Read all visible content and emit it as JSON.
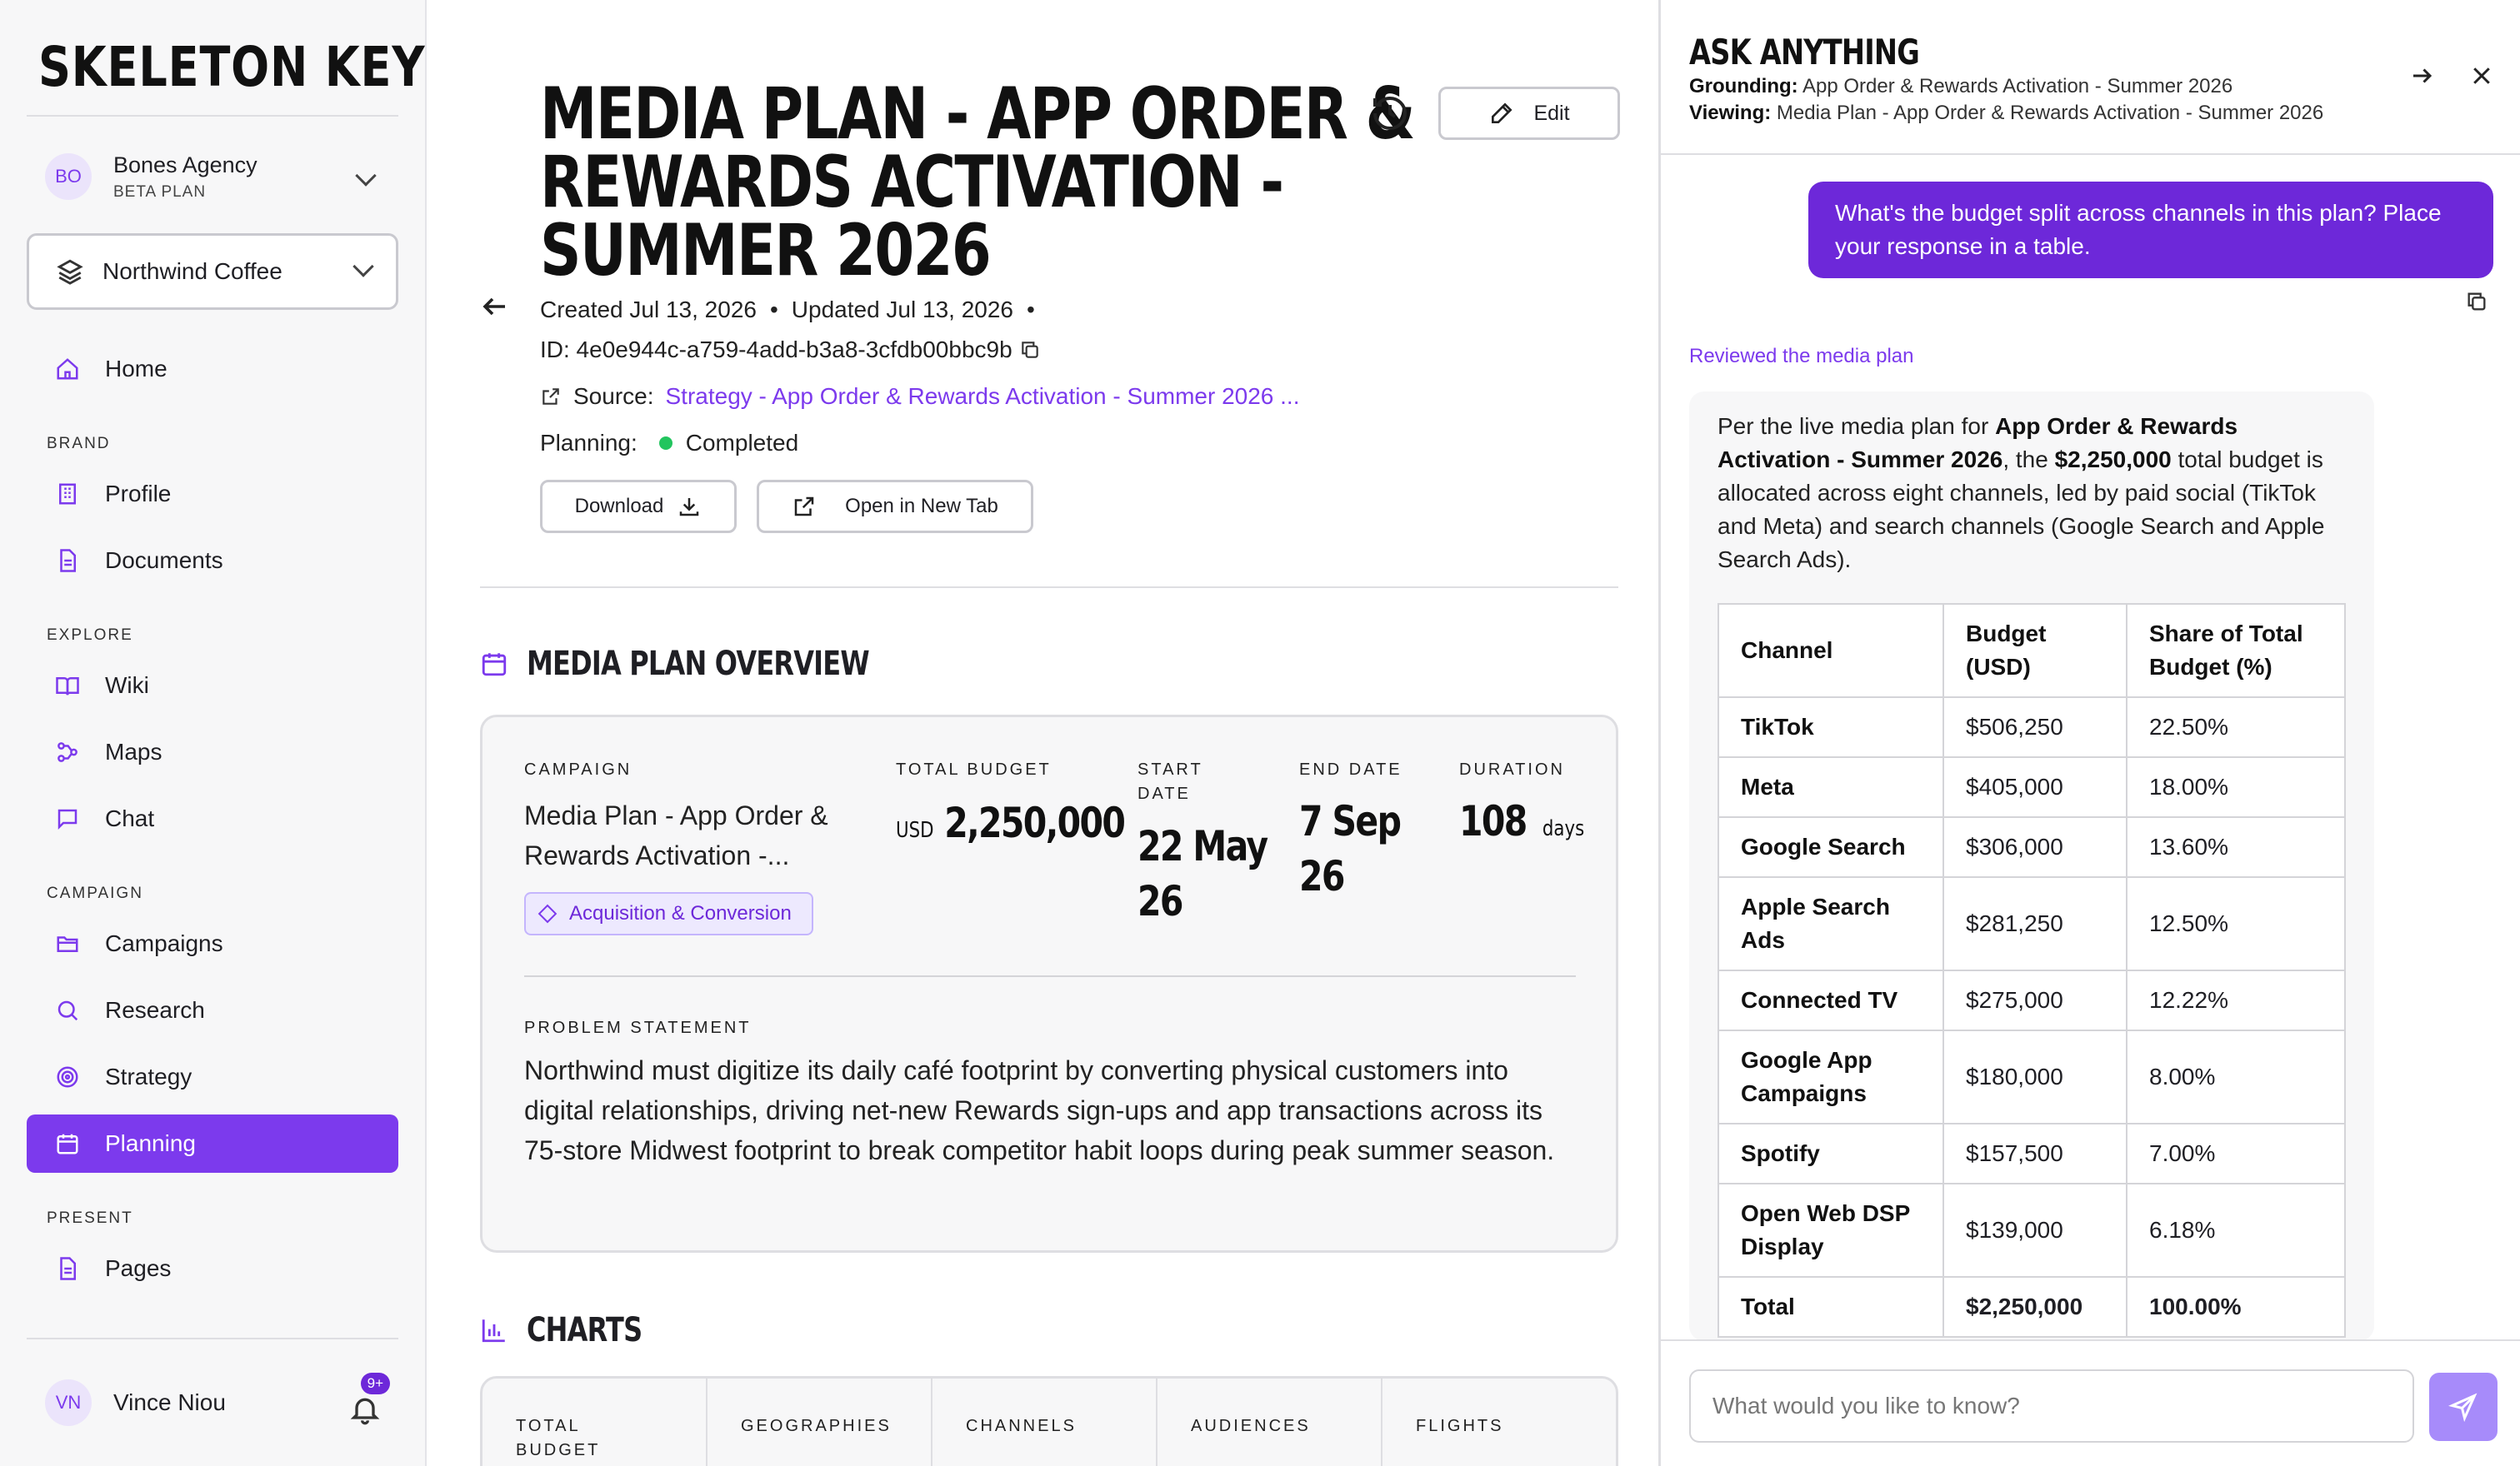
{
  "sidebar": {
    "logo": "SKELETON KEY",
    "agency": {
      "initials": "BO",
      "name": "Bones Agency",
      "plan": "BETA PLAN"
    },
    "brand_selector": "Northwind Coffee",
    "home": "Home",
    "sections": {
      "brand": "BRAND",
      "explore": "EXPLORE",
      "campaign": "CAMPAIGN",
      "present": "PRESENT"
    },
    "items": {
      "profile": "Profile",
      "documents": "Documents",
      "wiki": "Wiki",
      "maps": "Maps",
      "chat": "Chat",
      "campaigns": "Campaigns",
      "research": "Research",
      "strategy": "Strategy",
      "planning": "Planning",
      "pages": "Pages"
    },
    "user": {
      "initials": "VN",
      "name": "Vince Niou",
      "notifications": "9+"
    }
  },
  "main": {
    "title_lines": [
      "MEDIA PLAN - APP ORDER &",
      "REWARDS ACTIVATION -",
      "SUMMER 2026"
    ],
    "edit_label": "Edit",
    "created": "Created Jul 13, 2026",
    "updated": "Updated Jul 13, 2026",
    "dot": "•",
    "id_text": "ID: 4e0e944c-a759-4add-b3a8-3cfdb00bbc9b",
    "source_label": "Source:",
    "source_link": "Strategy - App Order & Rewards Activation - Summer 2026 ...",
    "planning_label": "Planning:",
    "planning_status": "Completed",
    "download_label": "Download",
    "open_tab_label": "Open in New Tab",
    "overview_title": "MEDIA PLAN OVERVIEW",
    "overview": {
      "campaign_label": "CAMPAIGN",
      "campaign_name": "Media Plan - App Order & Rewards Activation -...",
      "tag": "Acquisition & Conversion",
      "budget_label": "TOTAL BUDGET",
      "budget_currency": "USD",
      "budget_value": "2,250,000",
      "start_label_1": "START",
      "start_label_2": "DATE",
      "start_1": "22 May",
      "start_2": "26",
      "end_label": "END DATE",
      "end_1": "7 Sep",
      "end_2": "26",
      "duration_label": "DURATION",
      "duration_value": "108",
      "duration_unit": "days",
      "problem_label": "PROBLEM STATEMENT",
      "problem_text": "Northwind must digitize its daily café footprint by converting physical customers into digital relationships, driving net-new Rewards sign-ups and app transactions across its 75-store Midwest footprint to break competitor habit loops during peak summer season."
    },
    "charts_title": "CHARTS",
    "charts_cols": {
      "total_budget_1": "TOTAL",
      "total_budget_2": "BUDGET",
      "geographies": "GEOGRAPHIES",
      "channels": "CHANNELS",
      "audiences": "AUDIENCES",
      "flights": "FLIGHTS"
    }
  },
  "panel": {
    "title": "ASK ANYTHING",
    "grounding_label": "Grounding:",
    "grounding_value": "App Order & Rewards Activation - Summer 2026",
    "viewing_label": "Viewing:",
    "viewing_value": "Media Plan - App Order & Rewards Activation - Summer 2026",
    "user_message": "What's the budget split across channels in this plan? Place your response in a table.",
    "reviewed": "Reviewed the media plan",
    "answer": {
      "p1": "Per the live media plan for ",
      "p1_bold": "App Order & Rewards Activation - Summer 2026",
      "p2": ", the ",
      "p2_bold": "$2,250,000",
      "p3": " total budget is allocated across eight channels, led by paid social (TikTok and Meta) and search channels (Google Search and Apple Search Ads)."
    },
    "table": {
      "headers": [
        "Channel",
        "Budget (USD)",
        "Share of Total Budget (%)"
      ],
      "rows": [
        [
          "TikTok",
          "$506,250",
          "22.50%"
        ],
        [
          "Meta",
          "$405,000",
          "18.00%"
        ],
        [
          "Google Search",
          "$306,000",
          "13.60%"
        ],
        [
          "Apple Search Ads",
          "$281,250",
          "12.50%"
        ],
        [
          "Connected TV",
          "$275,000",
          "12.22%"
        ],
        [
          "Google App Campaigns",
          "$180,000",
          "8.00%"
        ],
        [
          "Spotify",
          "$157,500",
          "7.00%"
        ],
        [
          "Open Web DSP Display",
          "$139,000",
          "6.18%"
        ],
        [
          "Total",
          "$2,250,000",
          "100.00%"
        ]
      ]
    },
    "input_placeholder": "What would you like to know?"
  }
}
